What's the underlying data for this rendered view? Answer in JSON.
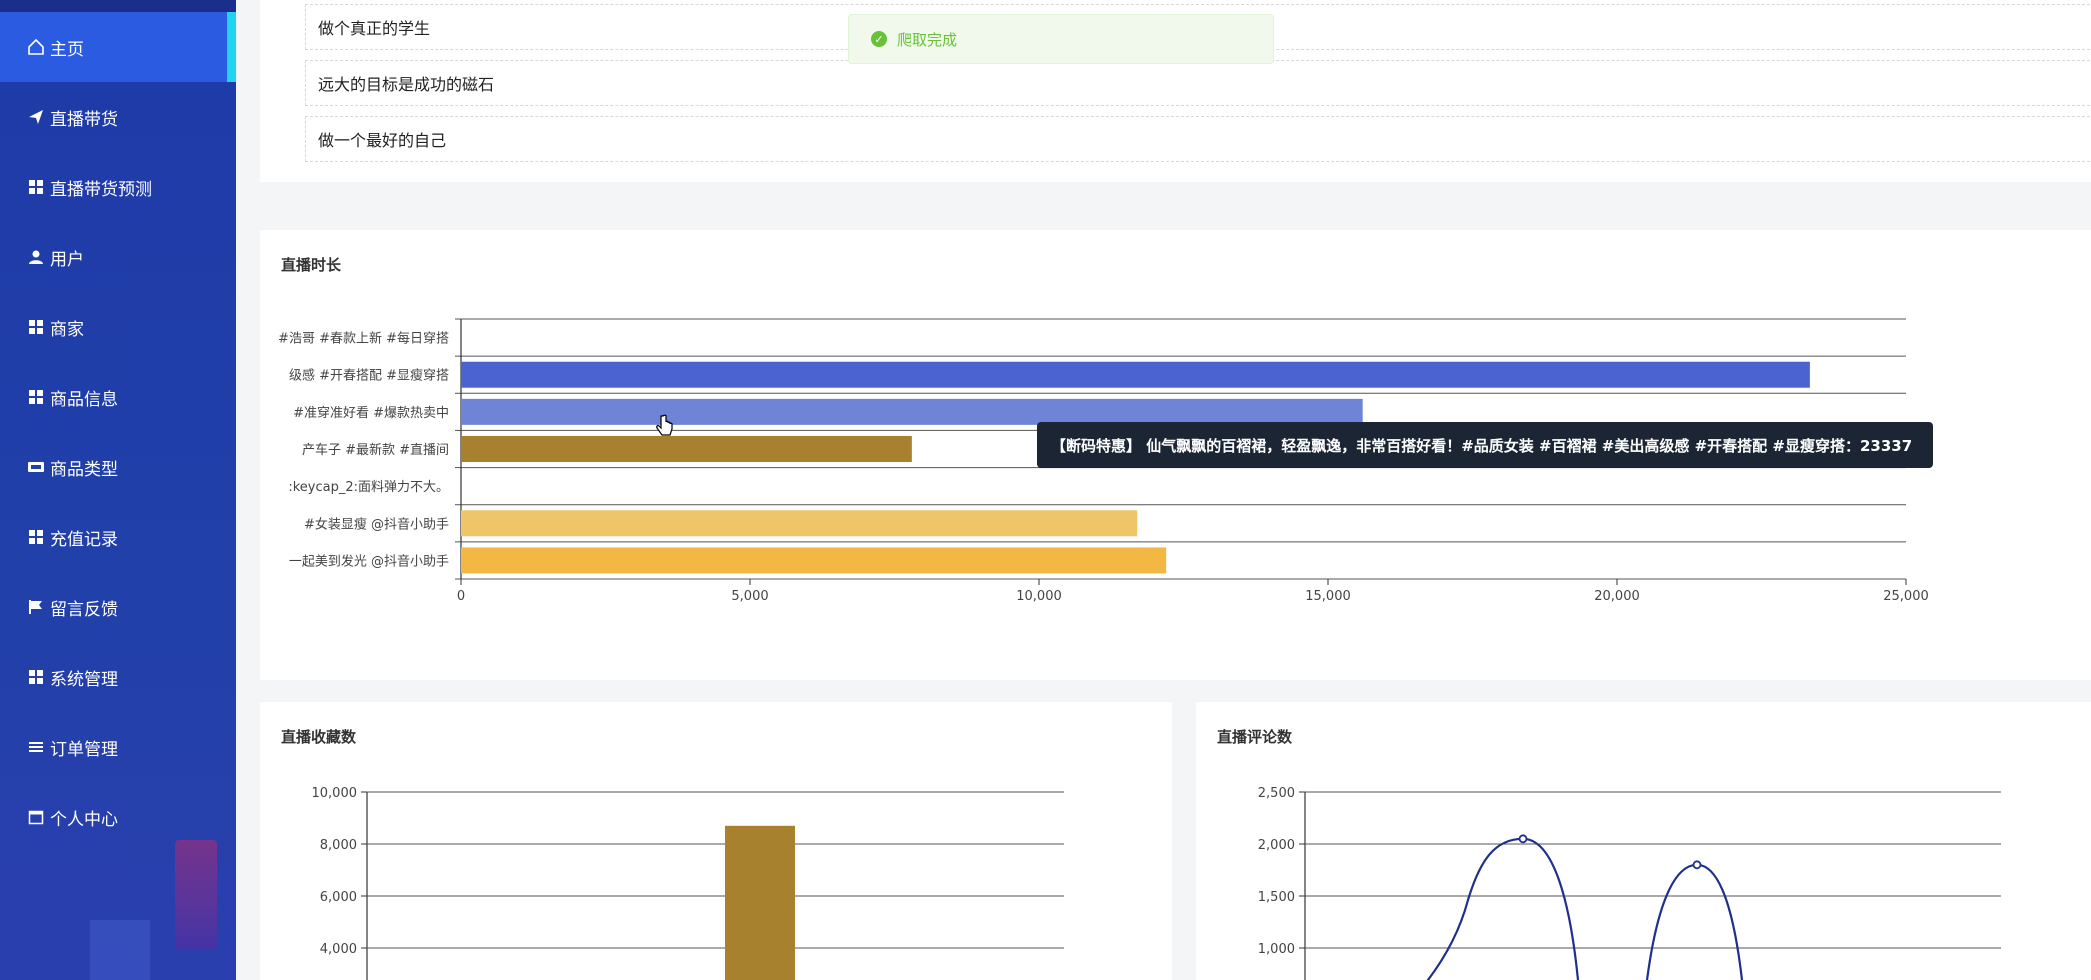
{
  "sidebar": {
    "items": [
      {
        "label": "主页",
        "icon": "home-icon",
        "active": true
      },
      {
        "label": "直播带货",
        "icon": "send-icon"
      },
      {
        "label": "直播带货预测",
        "icon": "grid-icon"
      },
      {
        "label": "用户",
        "icon": "user-icon"
      },
      {
        "label": "商家",
        "icon": "grid-icon"
      },
      {
        "label": "商品信息",
        "icon": "grid-icon"
      },
      {
        "label": "商品类型",
        "icon": "ticket-icon"
      },
      {
        "label": "充值记录",
        "icon": "grid-icon"
      },
      {
        "label": "留言反馈",
        "icon": "flag-icon"
      },
      {
        "label": "系统管理",
        "icon": "grid-icon"
      },
      {
        "label": "订单管理",
        "icon": "list-icon"
      },
      {
        "label": "个人中心",
        "icon": "calendar-icon"
      }
    ]
  },
  "mottos": [
    "做个真正的学生",
    "远大的目标是成功的磁石",
    "做一个最好的自己"
  ],
  "toast": {
    "text": "爬取完成",
    "icon": "check-circle-icon"
  },
  "charts": {
    "duration": {
      "title": "直播时长"
    },
    "favorites": {
      "title": "直播收藏数"
    },
    "comments": {
      "title": "直播评论数"
    }
  },
  "tooltip": {
    "text": "【断码特惠】 仙气飘飘的百褶裙，轻盈飘逸，非常百搭好看！#品质女装 #百褶裙 #美出高级感 #开春搭配 #显瘦穿搭：23337"
  },
  "chart_data": [
    {
      "type": "bar",
      "orientation": "horizontal",
      "title": "直播时长",
      "categories": [
        "#浩哥 #春款上新 #每日穿搭",
        "级感 #开春搭配 #显瘦穿搭",
        "#准穿准好看 #爆款热卖中",
        "产车子 #最新款 #直播间",
        ":keycap_2:面料弹力不大。",
        "#女装显瘦 @抖音小助手",
        "一起美到发光 @抖音小助手"
      ],
      "values": [
        0,
        23337,
        15600,
        7800,
        0,
        11700,
        12200
      ],
      "colors": [
        "#4b63cf",
        "#4b63cf",
        "#6f84d6",
        "#a8812e",
        "#000000",
        "#efc56a",
        "#f2b843"
      ],
      "xlim": [
        0,
        25000
      ],
      "xticks": [
        "0",
        "5,000",
        "10,000",
        "15,000",
        "20,000",
        "25,000"
      ],
      "grid": true
    },
    {
      "type": "bar",
      "title": "直播收藏数",
      "yticks": [
        "4,000",
        "6,000",
        "8,000",
        "10,000"
      ],
      "ylim": [
        0,
        10000
      ],
      "visible_bars": [
        {
          "value": 8700,
          "color": "#a8812e"
        }
      ],
      "grid": true
    },
    {
      "type": "line",
      "title": "直播评论数",
      "yticks": [
        "1,000",
        "1,500",
        "2,000",
        "2,500"
      ],
      "ylim": [
        0,
        2500
      ],
      "peaks": [
        2050,
        1800
      ],
      "line_color": "#1f2f8c",
      "grid": true
    }
  ]
}
